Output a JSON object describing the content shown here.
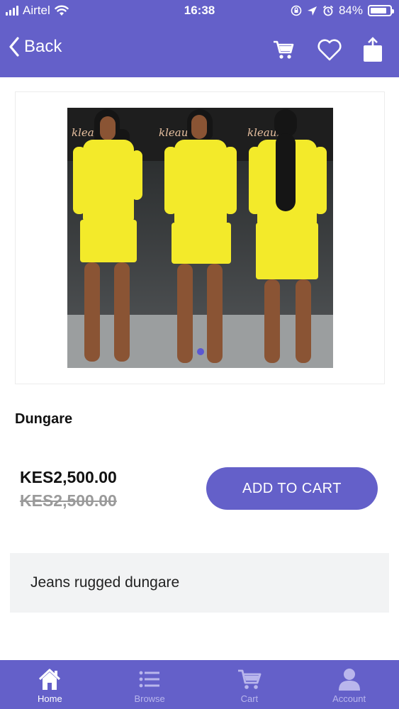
{
  "status_bar": {
    "carrier": "Airtel",
    "time": "16:38",
    "battery": "84%",
    "battery_level": 0.84
  },
  "nav": {
    "back_label": "Back",
    "icons": [
      "cart-icon",
      "heart-icon",
      "share-icon"
    ]
  },
  "product": {
    "image_sign_text": "kleaux",
    "carousel_page": 1,
    "title": "Dungare",
    "price_current": "KES2,500.00",
    "price_original": "KES2,500.00",
    "add_to_cart_label": "ADD TO CART",
    "description": "Jeans rugged dungare"
  },
  "tabs": [
    {
      "label": "Home",
      "icon": "home-icon",
      "active": true
    },
    {
      "label": "Browse",
      "icon": "list-icon",
      "active": false
    },
    {
      "label": "Cart",
      "icon": "cart-icon",
      "active": false
    },
    {
      "label": "Account",
      "icon": "user-icon",
      "active": false
    }
  ],
  "colors": {
    "accent": "#6460c9",
    "inactive_tab": "#b9b6ec",
    "description_bg": "#f2f3f4",
    "strike_price": "#9a9a9a"
  }
}
